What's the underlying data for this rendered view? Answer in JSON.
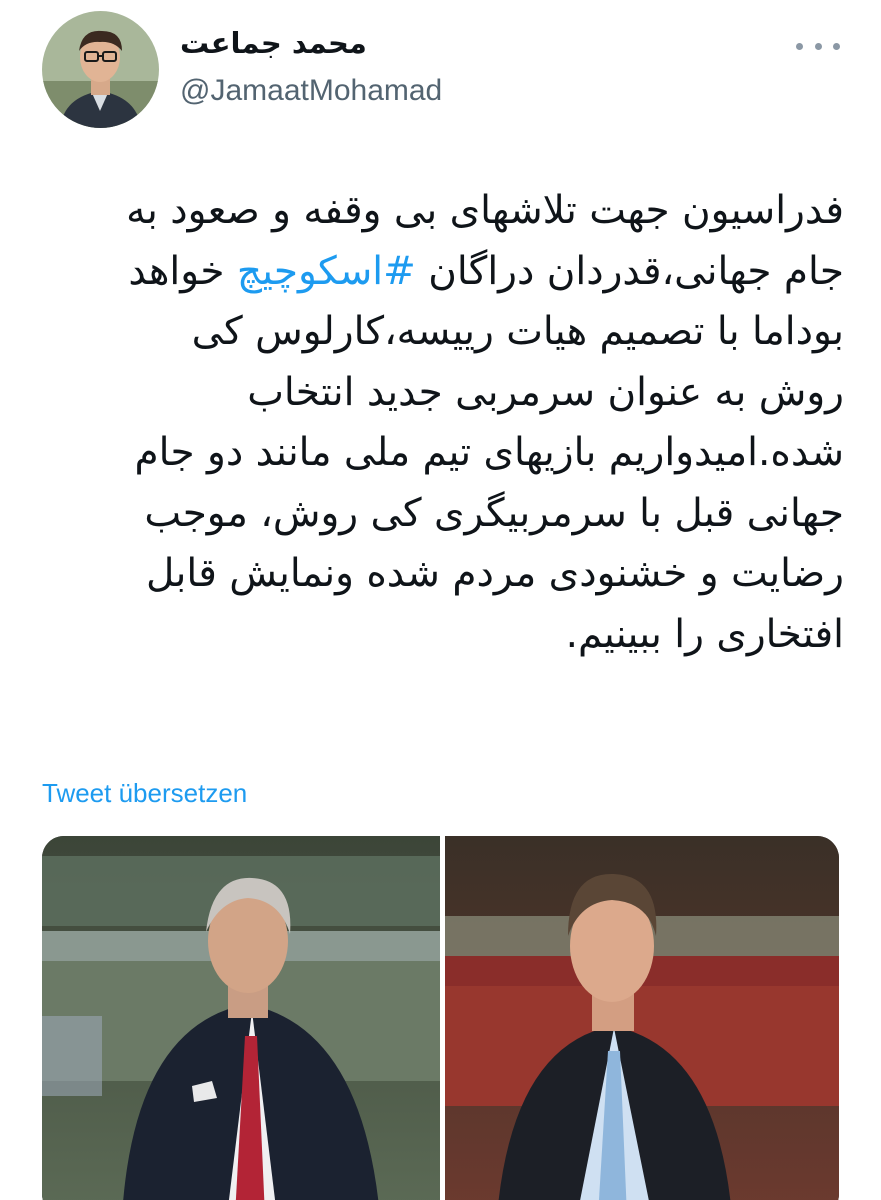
{
  "author": {
    "display_name": "محمد جماعت",
    "handle": "@JamaatMohamad",
    "avatar_icon": "profile-photo-man-glasses"
  },
  "more_icon": "more-horizontal-icon",
  "tweet": {
    "lines": [
      [
        "فدراسیون جهت تلاشهای بی وقفه و صعود به"
      ],
      [
        "جام جهانی،قدردان دراگان ",
        {
          "hashtag": "#اسکوچیچ"
        },
        " خواهد"
      ],
      [
        "بوداما با تصمیم هیات رییسه،کارلوس کی"
      ],
      [
        "روش به عنوان سرمربی جدید انتخاب"
      ],
      [
        "شده.امیدواریم بازیهای تیم ملی مانند دو جام"
      ],
      [
        "جهانی قبل با سرمربیگری کی روش، موجب"
      ],
      [
        "رضایت و خشنودی مردم شده ونمایش قابل"
      ],
      [
        "افتخاری را ببینیم."
      ]
    ]
  },
  "translate_label": "Tweet übersetzen",
  "media": {
    "left_photo": "coach-in-stadium-with-red-tie",
    "right_photo": "coach-in-stadium-with-blue-tie"
  },
  "colors": {
    "link": "#1d9bf0",
    "text": "#0f1419",
    "secondary": "#536471"
  }
}
